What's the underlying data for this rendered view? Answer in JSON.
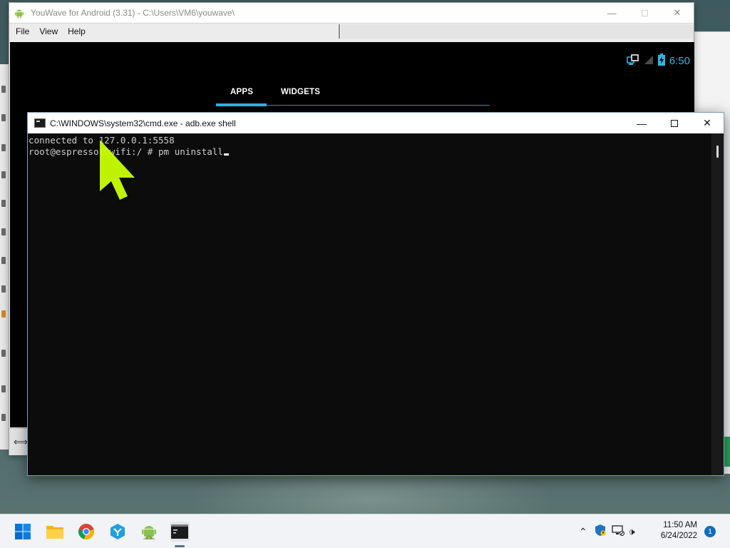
{
  "youwave": {
    "title": "YouWave for Android (3.31) - C:\\Users\\VM6\\youwave\\",
    "menu": [
      "File",
      "View",
      "Help"
    ],
    "status_time": "6:50",
    "tabs": [
      "APPS",
      "WIDGETS"
    ],
    "active_tab": "APPS"
  },
  "cmd": {
    "title": "C:\\WINDOWS\\system32\\cmd.exe - adb.exe  shell",
    "lines": [
      "connected to 127.0.0.1:5558",
      "root@espresso10wifi:/ # pm uninstall"
    ]
  },
  "taskbar": {
    "apps": [
      "start-icon",
      "file-explorer-icon",
      "chrome-icon",
      "youwave-icon",
      "android-icon",
      "cmd-icon"
    ],
    "clock_time": "11:50 AM",
    "clock_date": "6/24/2022",
    "notification_count": "1"
  },
  "colors": {
    "android_accent": "#33b5e5",
    "highlight_cursor": "#c8ff00",
    "cmd_background": "#0c0c0c"
  }
}
